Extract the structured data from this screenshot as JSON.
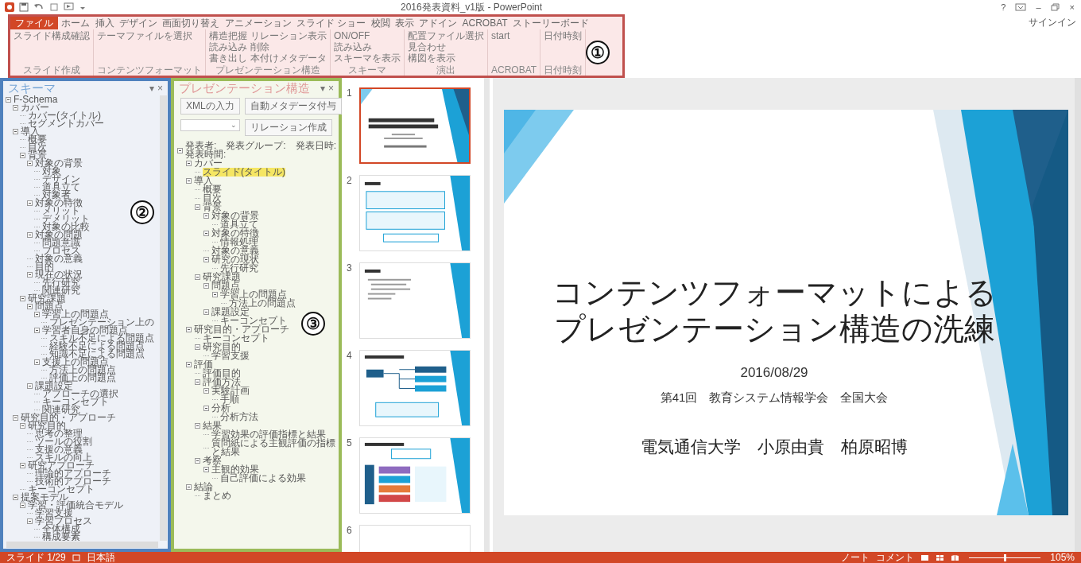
{
  "window": {
    "title": "2016発表資料_v1版 - PowerPoint",
    "help": "?",
    "minimize": "–",
    "close": "×",
    "sign_in": "サインイン"
  },
  "ribbon": {
    "tabs": [
      {
        "label": "ファイル",
        "selected": true
      },
      {
        "label": "ホーム",
        "selected": false
      },
      {
        "label": "挿入",
        "selected": false
      },
      {
        "label": "デザイン",
        "selected": false
      },
      {
        "label": "画面切り替え",
        "selected": false
      },
      {
        "label": "アニメーション",
        "selected": false
      },
      {
        "label": "スライド ショー",
        "selected": false
      },
      {
        "label": "校閲",
        "selected": false
      },
      {
        "label": "表示",
        "selected": false
      },
      {
        "label": "アドイン",
        "selected": false
      },
      {
        "label": "ACROBAT",
        "selected": false
      },
      {
        "label": "ストーリーボード",
        "selected": false
      }
    ],
    "groups": [
      {
        "label": "スライド作成",
        "columns": [
          [
            "スライド構成確認"
          ]
        ]
      },
      {
        "label": "コンテンツフォーマット",
        "columns": [
          [
            "テーマファイルを選択"
          ]
        ]
      },
      {
        "label": "プレゼンテーション構造",
        "columns": [
          [
            "構造把握",
            "読み込み",
            "書き出し"
          ],
          [
            "リレーション表示",
            "削除",
            "本付けメタデータ"
          ]
        ]
      },
      {
        "label": "スキーマ",
        "columns": [
          [
            "ON/OFF",
            "読み込み",
            "スキーマを表示"
          ]
        ]
      },
      {
        "label": "演出",
        "columns": [
          [
            "配置ファイル選択",
            "見合わせ",
            "構図を表示"
          ]
        ]
      },
      {
        "label": "ACROBAT",
        "columns": [
          [
            "start"
          ]
        ]
      },
      {
        "label": "日付時刻",
        "columns": [
          [
            "日付時刻"
          ]
        ]
      }
    ]
  },
  "annotations": [
    "①",
    "②",
    "③"
  ],
  "schema_pane": {
    "title": "スキーマ",
    "menu": "▾",
    "close": "×",
    "tree": [
      {
        "label": "F-Schema",
        "expanded": true,
        "children": [
          {
            "label": "カバー",
            "expanded": true,
            "children": [
              {
                "label": "カバー(タイトル)"
              },
              {
                "label": "セグメントカバー"
              }
            ]
          },
          {
            "label": "導入",
            "expanded": true,
            "children": [
              {
                "label": "概要"
              },
              {
                "label": "目次"
              },
              {
                "label": "背景",
                "expanded": true,
                "children": [
                  {
                    "label": "対象の背景",
                    "expanded": true,
                    "children": [
                      {
                        "label": "対象"
                      },
                      {
                        "label": "デザイン"
                      },
                      {
                        "label": "道具立て"
                      },
                      {
                        "label": "対象者"
                      }
                    ]
                  },
                  {
                    "label": "対象の特徴",
                    "expanded": true,
                    "children": [
                      {
                        "label": "メリット"
                      },
                      {
                        "label": "デメリット"
                      },
                      {
                        "label": "対象の比較"
                      }
                    ]
                  },
                  {
                    "label": "対象の問題",
                    "expanded": true,
                    "children": [
                      {
                        "label": "問題意識"
                      },
                      {
                        "label": "プロセス"
                      }
                    ]
                  },
                  {
                    "label": "対象の意義"
                  },
                  {
                    "label": "目的"
                  },
                  {
                    "label": "現在の状況",
                    "expanded": true,
                    "children": [
                      {
                        "label": "先行研究"
                      },
                      {
                        "label": "関連研究"
                      }
                    ]
                  }
                ]
              },
              {
                "label": "研究課題",
                "expanded": true,
                "children": [
                  {
                    "label": "問題点",
                    "expanded": true,
                    "children": [
                      {
                        "label": "学習上の問題点",
                        "expanded": true,
                        "children": [
                          {
                            "label": "プレゼンテーション上の"
                          }
                        ]
                      },
                      {
                        "label": "学習者自身の問題点",
                        "expanded": true,
                        "children": [
                          {
                            "label": "スキル不足による問題点"
                          },
                          {
                            "label": "経験不足による問題点"
                          },
                          {
                            "label": "知識不足による問題点"
                          }
                        ]
                      },
                      {
                        "label": "支援上の問題点",
                        "expanded": true,
                        "children": [
                          {
                            "label": "方法上の問題点"
                          },
                          {
                            "label": "評価上の問題点"
                          }
                        ]
                      }
                    ]
                  },
                  {
                    "label": "課題設定",
                    "expanded": true,
                    "children": [
                      {
                        "label": "アプローチの選択"
                      },
                      {
                        "label": "キーコンセプト"
                      },
                      {
                        "label": "関連研究"
                      }
                    ]
                  }
                ]
              }
            ]
          },
          {
            "label": "研究目的・アプローチ",
            "expanded": true,
            "children": [
              {
                "label": "研究目的",
                "expanded": true,
                "children": [
                  {
                    "label": "思考の整理"
                  },
                  {
                    "label": "ツールの役割"
                  },
                  {
                    "label": "支援の意義"
                  },
                  {
                    "label": "スキルの向上"
                  }
                ]
              },
              {
                "label": "研究アプローチ",
                "expanded": true,
                "children": [
                  {
                    "label": "理論的アプローチ"
                  },
                  {
                    "label": "技術的アプローチ"
                  }
                ]
              },
              {
                "label": "キーコンセプト"
              }
            ]
          },
          {
            "label": "提案モデル",
            "expanded": true,
            "children": [
              {
                "label": "学習・評価統合モデル",
                "expanded": true,
                "children": [
                  {
                    "label": "学習支援"
                  },
                  {
                    "label": "学習プロセス",
                    "expanded": true,
                    "children": [
                      {
                        "label": "全体構成"
                      },
                      {
                        "label": "構成要素"
                      }
                    ]
                  }
                ]
              }
            ]
          }
        ]
      }
    ]
  },
  "structure_pane": {
    "title": "プレゼンテーション構造",
    "menu": "▾",
    "close": "×",
    "buttons": [
      "XMLの入力",
      "自動メタデータ付与"
    ],
    "dropdown": {
      "arrow": "⌄"
    },
    "relation_button": "リレーション作成",
    "tree": [
      {
        "label": "発表者:　発表グループ:　発表日時:　発表時間:",
        "selected": false,
        "expanded": true,
        "children": [
          {
            "label": "カバー",
            "selected": false,
            "expanded": true,
            "children": [
              {
                "label": "スライド(タイトル)",
                "selected": true
              }
            ]
          },
          {
            "label": "導入",
            "selected": false,
            "expanded": true,
            "children": [
              {
                "label": "概要",
                "selected": false
              },
              {
                "label": "目次",
                "selected": false
              },
              {
                "label": "背景",
                "selected": false,
                "expanded": true,
                "children": [
                  {
                    "label": "対象の背景",
                    "selected": false,
                    "expanded": true,
                    "children": [
                      {
                        "label": "道具立て",
                        "selected": false
                      }
                    ]
                  },
                  {
                    "label": "対象の特徴",
                    "selected": false,
                    "expanded": true,
                    "children": [
                      {
                        "label": "情報処理",
                        "selected": false
                      }
                    ]
                  },
                  {
                    "label": "対象の意義",
                    "selected": false
                  },
                  {
                    "label": "研究の現状",
                    "selected": false,
                    "expanded": true,
                    "children": [
                      {
                        "label": "先行研究",
                        "selected": false
                      }
                    ]
                  }
                ]
              },
              {
                "label": "研究課題",
                "selected": false,
                "expanded": true,
                "children": [
                  {
                    "label": "問題点",
                    "selected": false,
                    "expanded": true,
                    "children": [
                      {
                        "label": "学習上の問題点",
                        "selected": false,
                        "expanded": true,
                        "children": [
                          {
                            "label": "方法上の問題点",
                            "selected": false
                          }
                        ]
                      }
                    ]
                  },
                  {
                    "label": "課題設定",
                    "selected": false,
                    "expanded": true,
                    "children": [
                      {
                        "label": "キーコンセプト",
                        "selected": false
                      }
                    ]
                  }
                ]
              }
            ]
          },
          {
            "label": "研究目的・アプローチ",
            "selected": false,
            "expanded": true,
            "children": [
              {
                "label": "キーコンセプト",
                "selected": false
              },
              {
                "label": "研究目的",
                "selected": false,
                "expanded": true,
                "children": [
                  {
                    "label": "学習支援",
                    "selected": false
                  }
                ]
              }
            ]
          },
          {
            "label": "評価",
            "selected": false,
            "expanded": true,
            "children": [
              {
                "label": "評価目的",
                "selected": false
              },
              {
                "label": "評価方法",
                "selected": false,
                "expanded": true,
                "children": [
                  {
                    "label": "実験計画",
                    "selected": false,
                    "expanded": true,
                    "children": [
                      {
                        "label": "手順",
                        "selected": false
                      }
                    ]
                  },
                  {
                    "label": "分析",
                    "selected": false,
                    "expanded": true,
                    "children": [
                      {
                        "label": "分析方法",
                        "selected": false
                      }
                    ]
                  }
                ]
              },
              {
                "label": "結果",
                "selected": false,
                "expanded": true,
                "children": [
                  {
                    "label": "学習効果の評価指標と結果",
                    "selected": false
                  },
                  {
                    "label": "質問紙による主観評価の指標と結果",
                    "selected": false
                  }
                ]
              },
              {
                "label": "考察",
                "selected": false,
                "expanded": true,
                "children": [
                  {
                    "label": "主観的効果",
                    "selected": false,
                    "expanded": true,
                    "children": [
                      {
                        "label": "自己評価による効果",
                        "selected": false
                      }
                    ]
                  }
                ]
              }
            ]
          },
          {
            "label": "結論",
            "selected": false,
            "expanded": true,
            "children": [
              {
                "label": "まとめ",
                "selected": false
              }
            ]
          }
        ]
      }
    ]
  },
  "thumbnails": [
    {
      "number": "1",
      "kind": "title",
      "selected": true
    },
    {
      "number": "2",
      "kind": "list",
      "selected": false
    },
    {
      "number": "3",
      "kind": "text",
      "selected": false
    },
    {
      "number": "4",
      "kind": "diagram",
      "selected": false
    },
    {
      "number": "5",
      "kind": "chart",
      "selected": false
    },
    {
      "number": "6",
      "kind": "hidden",
      "selected": false
    }
  ],
  "slide": {
    "title_lines": [
      "コンテンツフォーマットによる",
      "プレゼンテーション構造の洗練"
    ],
    "date": "2016/08/29",
    "event": "第41回　教育システム情報学会　全国大会",
    "authors": "電気通信大学　小原由貴　柏原昭博"
  },
  "status_bar": {
    "slide_counter": "スライド 1/29",
    "language": "日本語",
    "notes": "ノート",
    "comments": "コメント",
    "zoom": {
      "level": 0.5
    },
    "zoom_percent": "105%"
  }
}
